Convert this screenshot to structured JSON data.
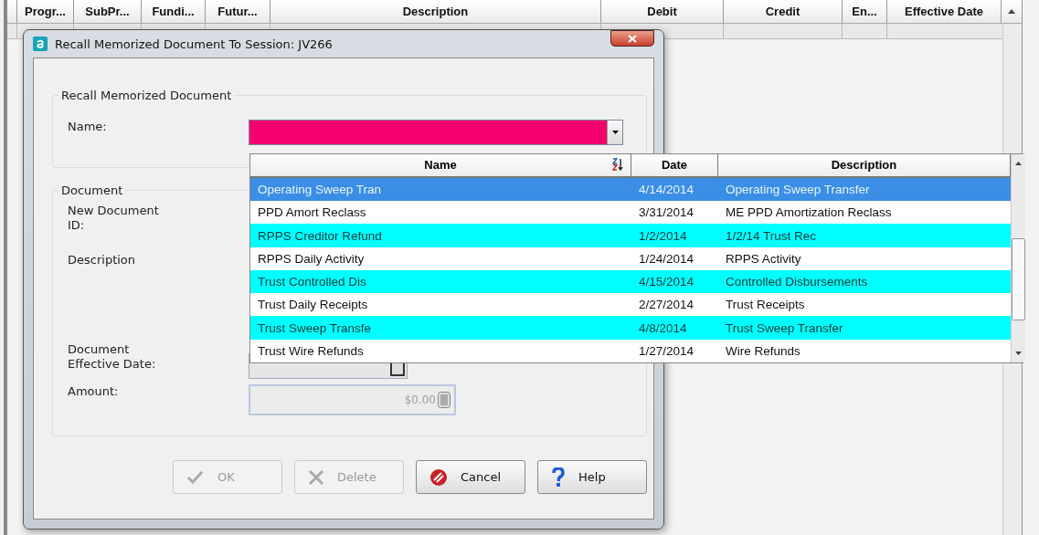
{
  "grid": {
    "columns": [
      "Progr...",
      "SubPr...",
      "Fundi...",
      "Futur...",
      "Description",
      "Debit",
      "Credit",
      "En...",
      "Effective Date"
    ]
  },
  "dialog": {
    "title": "Recall Memorized Document To Session: JV266",
    "recall_group": {
      "legend": "Recall Memorized Document",
      "name_label": "Name:",
      "name_required": true
    },
    "document_group": {
      "legend": "Document",
      "fields": [
        {
          "kind": "id",
          "label": "New Document ID:"
        },
        {
          "kind": "description",
          "label": "Description"
        },
        {
          "kind": "date",
          "label": "Document Effective Date:"
        },
        {
          "kind": "amount",
          "label": "Amount:",
          "value": "$0.00",
          "disabled": true
        }
      ]
    },
    "buttons": [
      {
        "kind": "check",
        "label": "OK",
        "disabled": true
      },
      {
        "kind": "delete",
        "label": "Delete",
        "disabled": true
      },
      {
        "kind": "cancel",
        "label": "Cancel",
        "disabled": false
      },
      {
        "kind": "help",
        "label": "Help",
        "disabled": false
      }
    ]
  },
  "dropdown": {
    "columns": [
      {
        "label": "Name",
        "sorted": true
      },
      {
        "label": "Date",
        "sorted": false
      },
      {
        "label": "Description",
        "sorted": false
      }
    ],
    "rows": [
      {
        "name": "Operating Sweep Tran",
        "date": "4/14/2014",
        "description": "Operating Sweep Transfer",
        "selected": true,
        "highlighted": false
      },
      {
        "name": "PPD Amort Reclass",
        "date": "3/31/2014",
        "description": "ME PPD Amortization Reclass",
        "selected": false,
        "highlighted": false
      },
      {
        "name": "RPPS Creditor Refund",
        "date": "1/2/2014",
        "description": "1/2/14 Trust Rec",
        "selected": false,
        "highlighted": true
      },
      {
        "name": "RPPS Daily Activity",
        "date": "1/24/2014",
        "description": "RPPS Activity",
        "selected": false,
        "highlighted": false
      },
      {
        "name": "Trust Controlled Dis",
        "date": "4/15/2014",
        "description": "Controlled Disbursements",
        "selected": false,
        "highlighted": true
      },
      {
        "name": "Trust Daily Receipts",
        "date": "2/27/2014",
        "description": "Trust Receipts",
        "selected": false,
        "highlighted": false
      },
      {
        "name": "Trust Sweep Transfe",
        "date": "4/8/2014",
        "description": "Trust Sweep Transfer",
        "selected": false,
        "highlighted": true
      },
      {
        "name": "Trust Wire Refunds",
        "date": "1/27/2014",
        "description": "Wire Refunds",
        "selected": false,
        "highlighted": false
      }
    ]
  }
}
